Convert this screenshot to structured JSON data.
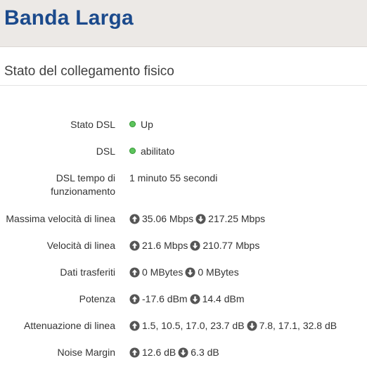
{
  "header": {
    "title": "Banda Larga"
  },
  "section": {
    "title": "Stato del collegamento fisico"
  },
  "rows": {
    "stato_dsl": {
      "label": "Stato DSL",
      "value": "Up",
      "status_color": "#5cc45c"
    },
    "dsl": {
      "label": "DSL",
      "value": "abilitato",
      "status_color": "#5cc45c"
    },
    "tempo": {
      "label_line1": "DSL tempo di",
      "label_line2": "funzionamento",
      "value": "1 minuto 55 secondi"
    },
    "max_velocita": {
      "label": "Massima velocità di linea",
      "up": "35.06 Mbps",
      "down": "217.25 Mbps"
    },
    "velocita": {
      "label": "Velocità di linea",
      "up": "21.6 Mbps",
      "down": "210.77 Mbps"
    },
    "dati": {
      "label": "Dati trasferiti",
      "up": "0 MBytes",
      "down": "0 MBytes"
    },
    "potenza": {
      "label": "Potenza",
      "up": "-17.6 dBm",
      "down": "14.4 dBm"
    },
    "attenuazione": {
      "label": "Attenuazione di linea",
      "up": "1.5, 10.5, 17.0, 23.7 dB",
      "down": "7.8, 17.1, 32.8 dB"
    },
    "noise": {
      "label": "Noise Margin",
      "up": "12.6 dB",
      "down": "6.3 dB"
    }
  },
  "icons": {
    "upload": "arrow-up-circle-icon",
    "download": "arrow-down-circle-icon",
    "status": "status-dot-icon"
  },
  "colors": {
    "title_blue": "#1b4a8c",
    "header_bg": "#ece9e6",
    "status_green": "#5cc45c"
  }
}
